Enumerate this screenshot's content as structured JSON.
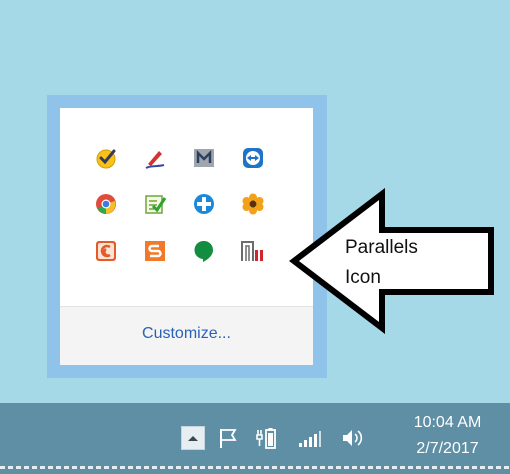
{
  "tray_flyout": {
    "customize_label": "Customize...",
    "icons": [
      "task-check-icon",
      "pen-icon",
      "mega-m-icon",
      "teamviewer-icon",
      "chrome-icon",
      "notes-check-icon",
      "medical-cross-icon",
      "flower-icon",
      "orange-swirl-icon",
      "app-s-icon",
      "hangouts-icon",
      "parallels-icon"
    ]
  },
  "annotation": {
    "line1": "Parallels",
    "line2": "Icon"
  },
  "taskbar": {
    "time": "10:04 AM",
    "date": "2/7/2017"
  },
  "colors": {
    "desktop": "#a6d9e8",
    "flyout_border": "#8fc3ea",
    "taskbar": "#5f8fa5",
    "link": "#2a62b8",
    "parallels_red": "#d3232f"
  }
}
